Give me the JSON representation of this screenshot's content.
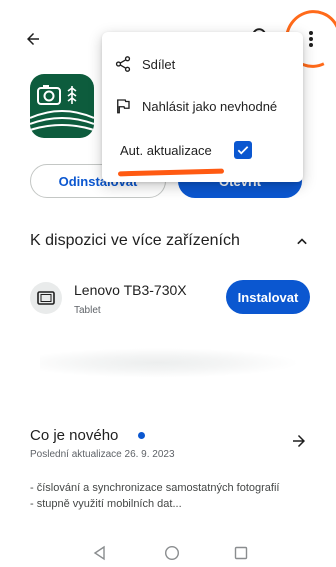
{
  "menu": {
    "share_label": "Sdílet",
    "report_label": "Nahlásit jako nevhodné",
    "auto_update_label": "Aut. aktualizace",
    "auto_update_checked": true
  },
  "app": {
    "uninstall_label": "Odinstalovat",
    "open_label": "Otevřít"
  },
  "devices": {
    "section_title": "K dispozici ve více zařízeních",
    "items": [
      {
        "name": "Lenovo TB3-730X",
        "type": "Tablet",
        "install_label": "Instalovat"
      }
    ]
  },
  "whats_new": {
    "title": "Co je nového",
    "last_update": "Poslední aktualizace 26. 9. 2023",
    "line1": "- číslování a synchronizace samostatných fotografií",
    "line2": "- stupně využití mobilních dat..."
  },
  "colors": {
    "accent": "#0b57d0",
    "annotation": "#ff5a12",
    "app_icon_bg": "#0d5c3d"
  },
  "icons": {
    "back": "arrow-left-icon",
    "search": "search-icon",
    "more": "more-vertical-icon",
    "share": "share-icon",
    "report": "flag-icon",
    "device": "tablet-icon",
    "collapse": "chevron-up-icon",
    "details": "arrow-right-icon"
  }
}
